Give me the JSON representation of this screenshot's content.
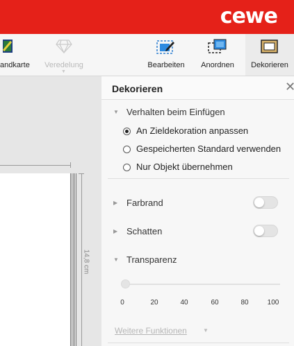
{
  "brand": {
    "logo_text": "cewe",
    "color": "#e52119"
  },
  "toolbar": {
    "items": [
      {
        "label": "andkarte",
        "icon": "map-icon",
        "enabled": true
      },
      {
        "label": "Veredelung",
        "icon": "diamond-icon",
        "enabled": false
      },
      {
        "label": "Bearbeiten",
        "icon": "edit-icon",
        "enabled": true
      },
      {
        "label": "Anordnen",
        "icon": "arrange-icon",
        "enabled": true
      },
      {
        "label": "Dekorieren",
        "icon": "decorate-frame-icon",
        "enabled": true,
        "selected": true
      }
    ]
  },
  "canvas": {
    "ruler_label": "14,8 cm"
  },
  "panel": {
    "title": "Dekorieren",
    "close_icon": "close-icon",
    "insert_behavior": {
      "label": "Verhalten beim Einfügen",
      "expanded": true,
      "options": [
        {
          "label": "An Zieldekoration anpassen",
          "selected": true
        },
        {
          "label": "Gespeicherten Standard verwenden",
          "selected": false
        },
        {
          "label": "Nur Objekt übernehmen",
          "selected": false
        }
      ]
    },
    "color_edge": {
      "label": "Farbrand",
      "expanded": false,
      "enabled": false
    },
    "shadow": {
      "label": "Schatten",
      "expanded": false,
      "enabled": false
    },
    "transparency": {
      "label": "Transparenz",
      "expanded": true,
      "value": 0,
      "ticks": [
        "0",
        "20",
        "40",
        "60",
        "80",
        "100"
      ]
    },
    "more_functions": "Weitere Funktionen"
  }
}
